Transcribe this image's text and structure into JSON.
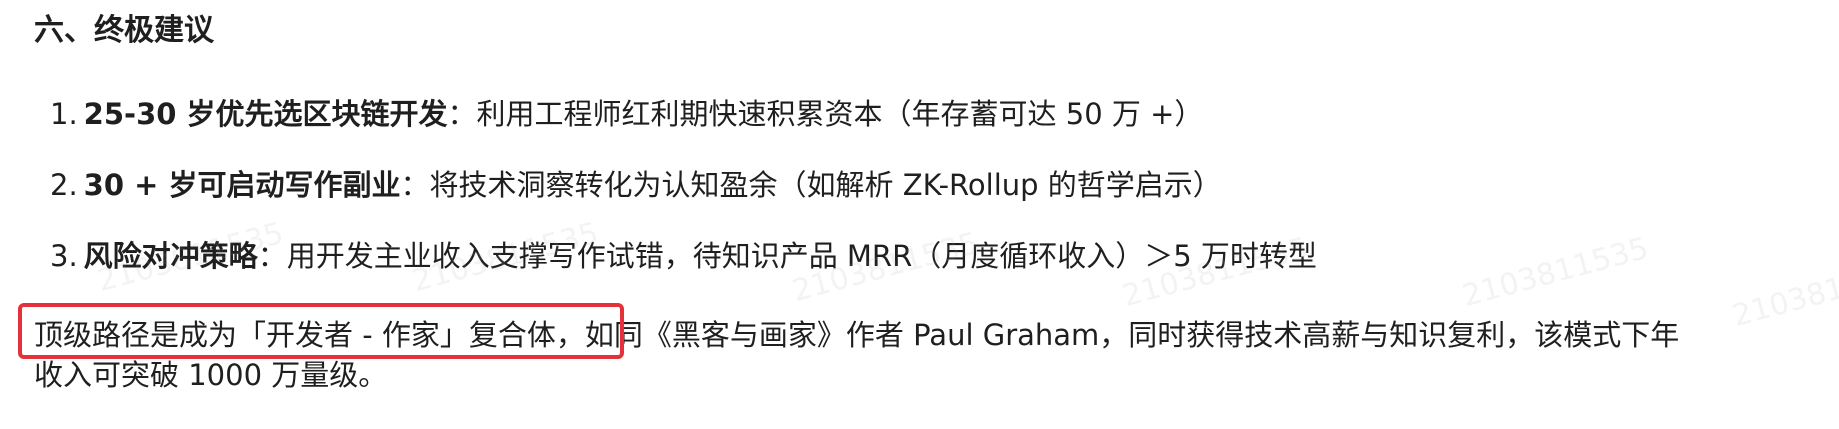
{
  "section": {
    "heading": "六、终极建议"
  },
  "list": [
    {
      "number": "1.",
      "bold": "25-30 岁优先选区块链开发",
      "rest": "：利用工程师红利期快速积累资本（年存蓄可达 50 万 +）"
    },
    {
      "number": "2.",
      "bold": "30 + 岁可启动写作副业",
      "rest": "：将技术洞察转化为认知盈余（如解析 ZK-Rollup 的哲学启示）"
    },
    {
      "number": "3.",
      "bold": "风险对冲策略",
      "rest": "：用开发主业收入支撑写作试错，待知识产品 MRR（月度循环收入）＞5 万时转型"
    }
  ],
  "conclusion": {
    "highlighted": "顶级路径是成为「开发者 - 作家」复合体，",
    "rest_line1": "如同《黑客与画家》作者 Paul Graham，同时获得技术高薪与知识复利，该模式下年",
    "line2": "收入可突破 1000 万量级。"
  },
  "watermark_text": "2103811535",
  "colors": {
    "text": "#1f1f1f",
    "highlight_border": "#e5323a"
  }
}
